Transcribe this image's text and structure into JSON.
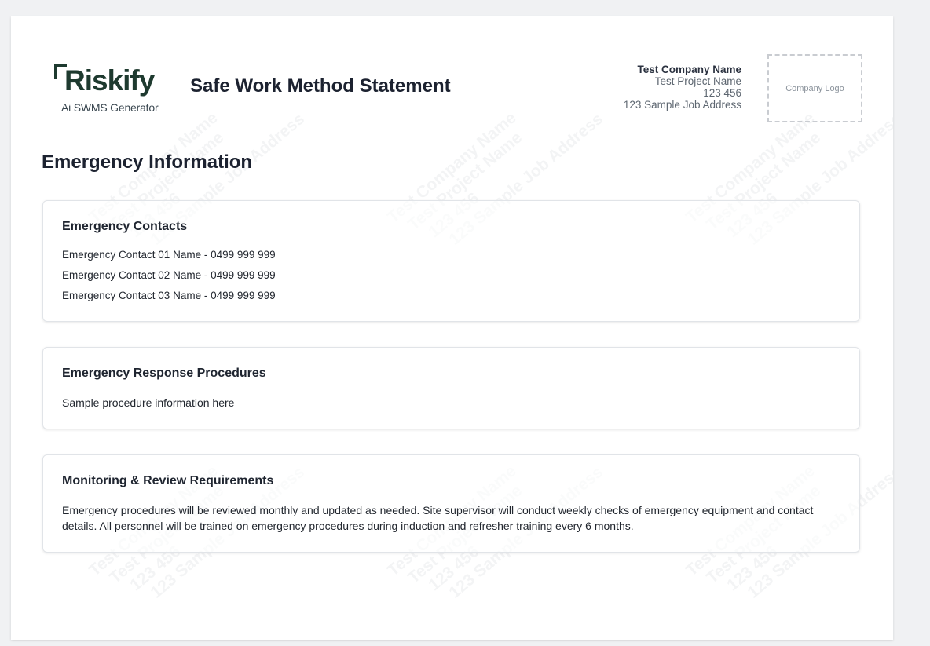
{
  "brand": {
    "logo_text": "Riskify",
    "logo_subtitle": "Ai SWMS Generator"
  },
  "header": {
    "doc_title": "Safe Work Method Statement"
  },
  "company": {
    "name": "Test Company Name",
    "project": "Test Project Name",
    "number": "123 456",
    "address": "123 Sample Job Address",
    "logo_placeholder": "Company Logo"
  },
  "watermark": [
    "Test Company Name",
    "Test Project Name",
    "123 456",
    "123 Sample Job Address"
  ],
  "section": {
    "title": "Emergency Information"
  },
  "cards": {
    "contacts": {
      "title": "Emergency Contacts",
      "items": [
        "Emergency Contact 01 Name - 0499 999 999",
        "Emergency Contact 02 Name - 0499 999 999",
        "Emergency Contact 03 Name - 0499 999 999"
      ]
    },
    "procedures": {
      "title": "Emergency Response Procedures",
      "text": "Sample procedure information here"
    },
    "monitoring": {
      "title": "Monitoring & Review Requirements",
      "text": "Emergency procedures will be reviewed monthly and updated as needed. Site supervisor will conduct weekly checks of emergency equipment and contact details. All personnel will be trained on emergency procedures during induction and refresher training every 6 months."
    }
  }
}
